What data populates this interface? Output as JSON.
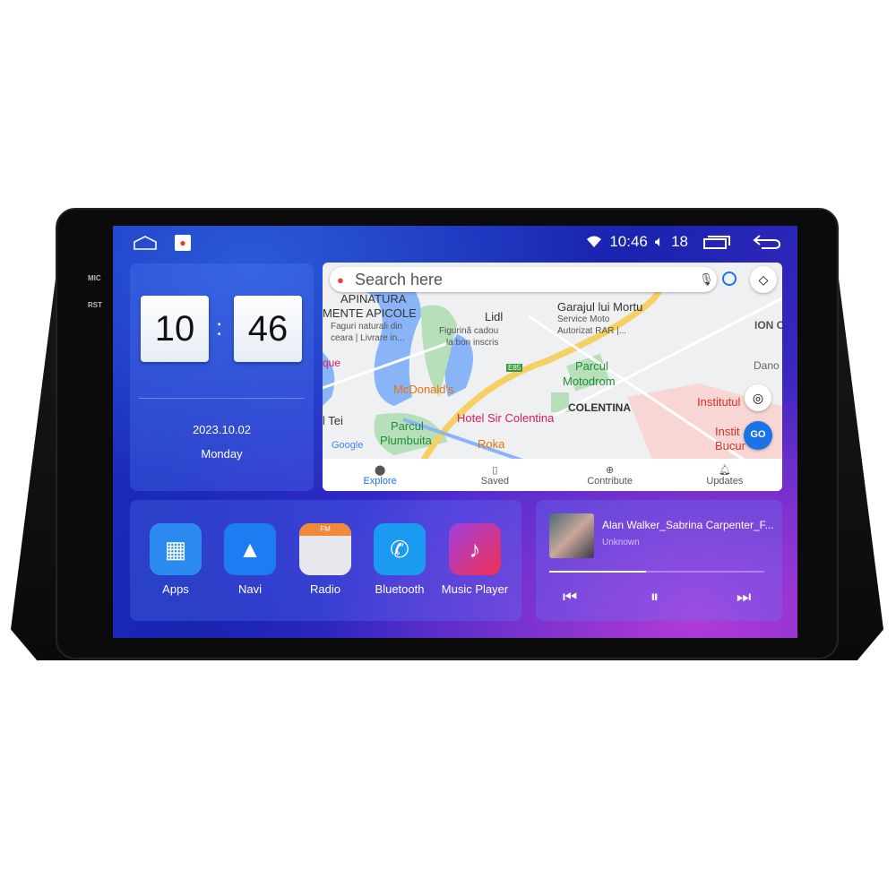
{
  "device": {
    "mic_label": "MIC",
    "rst_label": "RST"
  },
  "status_bar": {
    "time": "10:46",
    "volume": "18",
    "icons": [
      "home-icon",
      "maps-icon",
      "wifi-icon",
      "volume-icon",
      "recent-apps-icon",
      "back-icon"
    ]
  },
  "clock": {
    "hour": "10",
    "minute": "46",
    "separator": ":",
    "date": "2023.10.02",
    "weekday": "Monday"
  },
  "map": {
    "search_placeholder": "Search here",
    "labels": [
      "APINATURA",
      "MENTE APICOLE",
      "Faguri naturali din",
      "ceara | Livrare in...",
      "Lidl",
      "Figurină cadou",
      "la bon inscris",
      "Garajul lui Mortu",
      "Service Moto",
      "Autorizat RAR |...",
      "ION C",
      "Dano",
      "que",
      "Parcul",
      "Motodrom",
      "McDonald's",
      "COLENTINA",
      "Institutul",
      "Hotel Sir Colentina",
      "l Tei",
      "Parcul",
      "Plumbuita",
      "Roka",
      "Instit",
      "Bucur",
      "Google",
      "E85",
      "GO"
    ],
    "nav": [
      {
        "label": "Explore",
        "icon": "pin-icon",
        "active": true
      },
      {
        "label": "Saved",
        "icon": "bookmark-icon"
      },
      {
        "label": "Contribute",
        "icon": "plus-circle-icon"
      },
      {
        "label": "Updates",
        "icon": "bell-icon"
      }
    ]
  },
  "apps": [
    {
      "label": "Apps",
      "color": "#2a8af0"
    },
    {
      "label": "Navi",
      "color": "#1e7cf2"
    },
    {
      "label": "Radio",
      "color": "#e8e8ec",
      "badge": "FM"
    },
    {
      "label": "Bluetooth",
      "color": "#1a9af0"
    },
    {
      "label": "Music Player",
      "color": "#e8305a"
    }
  ],
  "music": {
    "title": "Alan Walker_Sabrina Carpenter_F...",
    "artist": "Unknown",
    "progress": 0.45
  },
  "colors": {
    "accent": "#1a73e8"
  }
}
